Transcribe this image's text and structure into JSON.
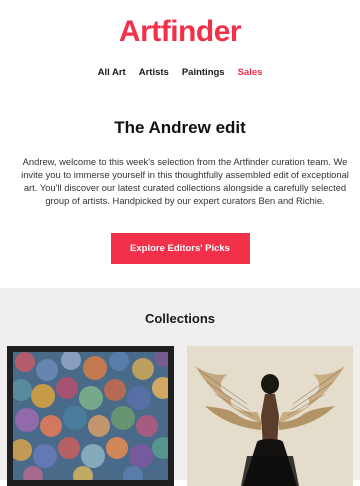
{
  "brand": {
    "logo_text": "Artfinder",
    "accent_color": "#f2304a"
  },
  "nav": {
    "items": [
      {
        "label": "All Art"
      },
      {
        "label": "Artists"
      },
      {
        "label": "Paintings"
      },
      {
        "label": "Sales"
      }
    ]
  },
  "hero": {
    "title": "The Andrew edit",
    "body": "Andrew, welcome to this week's selection from the Artfinder curation team. We invite you to immerse yourself in this thoughtfully assembled edit of exceptional art. You'll discover our latest curated collections alongside a carefully selected group of artists. Handpicked by our expert curators Ben and Richie.",
    "cta_label": "Explore Editors' Picks"
  },
  "collections": {
    "title": "Collections"
  }
}
